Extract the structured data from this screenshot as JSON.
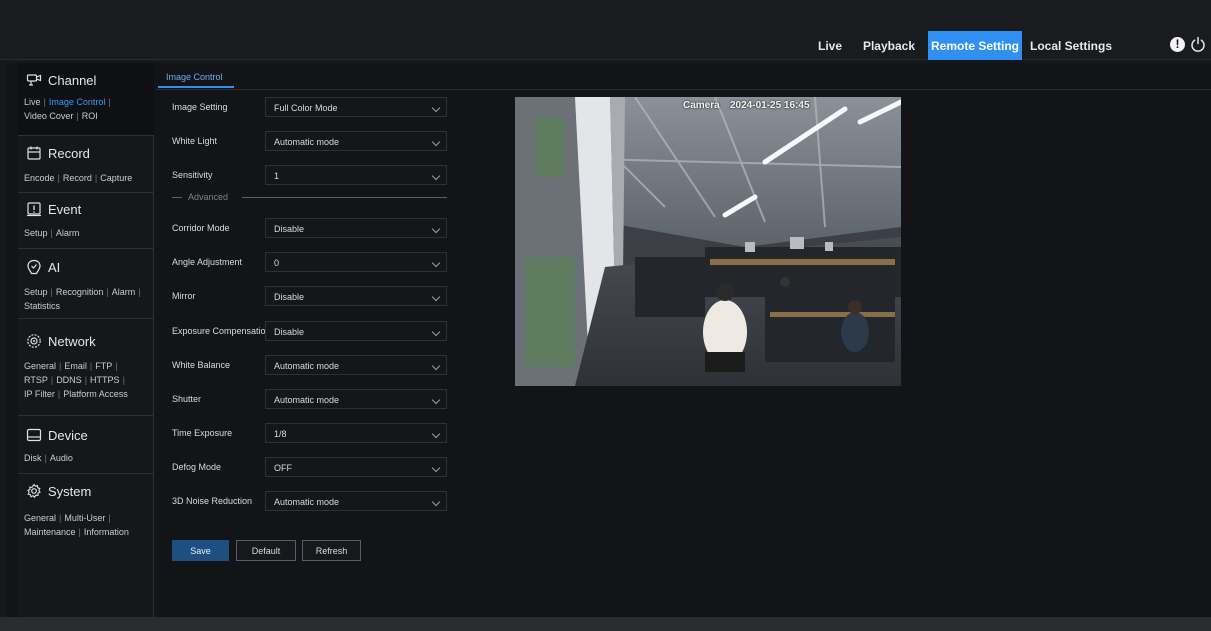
{
  "header": {
    "nav": [
      {
        "label": "Live"
      },
      {
        "label": "Playback"
      },
      {
        "label": "Remote Setting",
        "active": true
      },
      {
        "label": "Local Settings"
      }
    ],
    "accent_color": "#2f8ff2"
  },
  "sidebar": {
    "sections": [
      {
        "title": "Channel",
        "icon": "channel-icon",
        "links": [
          "Live",
          "Image Control",
          "Video Cover",
          "ROI"
        ],
        "active": "Image Control"
      },
      {
        "title": "Record",
        "icon": "record-icon",
        "links": [
          "Encode",
          "Record",
          "Capture"
        ]
      },
      {
        "title": "Event",
        "icon": "event-icon",
        "links": [
          "Setup",
          "Alarm"
        ]
      },
      {
        "title": "AI",
        "icon": "ai-icon",
        "links": [
          "Setup",
          "Recognition",
          "Alarm",
          "Statistics"
        ]
      },
      {
        "title": "Network",
        "icon": "network-icon",
        "links": [
          "General",
          "Email",
          "FTP",
          "RTSP",
          "DDNS",
          "HTTPS",
          "IP Filter",
          "Platform Access"
        ]
      },
      {
        "title": "Device",
        "icon": "device-icon",
        "links": [
          "Disk",
          "Audio"
        ]
      },
      {
        "title": "System",
        "icon": "system-icon",
        "links": [
          "General",
          "Multi-User",
          "Maintenance",
          "Information"
        ]
      }
    ]
  },
  "tabs": [
    {
      "label": "Image Control",
      "active": true
    }
  ],
  "form": {
    "advanced_label": "Advanced",
    "rows": [
      {
        "label": "Image Setting",
        "value": "Full Color Mode"
      },
      {
        "label": "White Light",
        "value": "Automatic mode"
      },
      {
        "label": "Sensitivity",
        "value": "1"
      },
      {
        "label": "Corridor Mode",
        "value": "Disable"
      },
      {
        "label": "Angle Adjustment",
        "value": "0"
      },
      {
        "label": "Mirror",
        "value": "Disable"
      },
      {
        "label": "Exposure Compensation",
        "value": "Disable"
      },
      {
        "label": "White Balance",
        "value": "Automatic mode"
      },
      {
        "label": "Shutter",
        "value": "Automatic mode"
      },
      {
        "label": "Time Exposure",
        "value": "1/8"
      },
      {
        "label": "Defog Mode",
        "value": "OFF"
      },
      {
        "label": "3D Noise Reduction",
        "value": "Automatic mode"
      }
    ],
    "buttons": {
      "save": "Save",
      "default": "Default",
      "refresh": "Refresh"
    }
  },
  "camera": {
    "name": "Camera",
    "timestamp": "2024-01-25 16:45"
  }
}
